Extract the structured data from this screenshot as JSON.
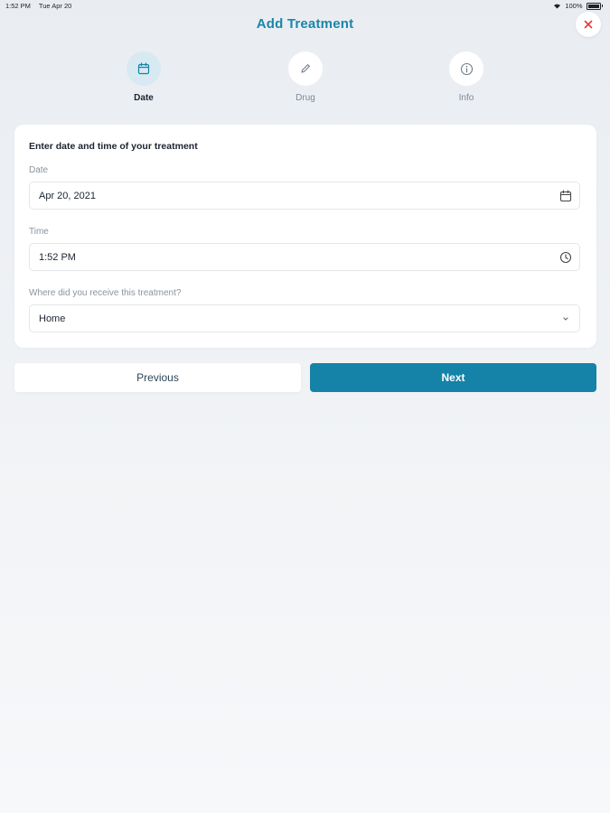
{
  "status_bar": {
    "time": "1:52 PM",
    "date": "Tue Apr 20",
    "battery": "100%"
  },
  "header": {
    "title": "Add Treatment",
    "close_icon": "close-icon"
  },
  "steps": [
    {
      "label": "Date",
      "icon": "calendar-icon",
      "active": true
    },
    {
      "label": "Drug",
      "icon": "pencil-icon",
      "active": false
    },
    {
      "label": "Info",
      "icon": "info-icon",
      "active": false
    }
  ],
  "form": {
    "heading": "Enter date and time of your treatment",
    "date": {
      "label": "Date",
      "value": "Apr 20, 2021",
      "icon": "calendar-icon"
    },
    "time": {
      "label": "Time",
      "value": "1:52 PM",
      "icon": "clock-icon"
    },
    "location": {
      "label": "Where did you receive this treatment?",
      "value": "Home",
      "icon": "chevron-down-icon"
    }
  },
  "buttons": {
    "previous": "Previous",
    "next": "Next"
  },
  "colors": {
    "accent": "#1583a7",
    "title": "#1a86a8",
    "close": "#e53935",
    "active_step_bg": "#d7eaf1"
  }
}
